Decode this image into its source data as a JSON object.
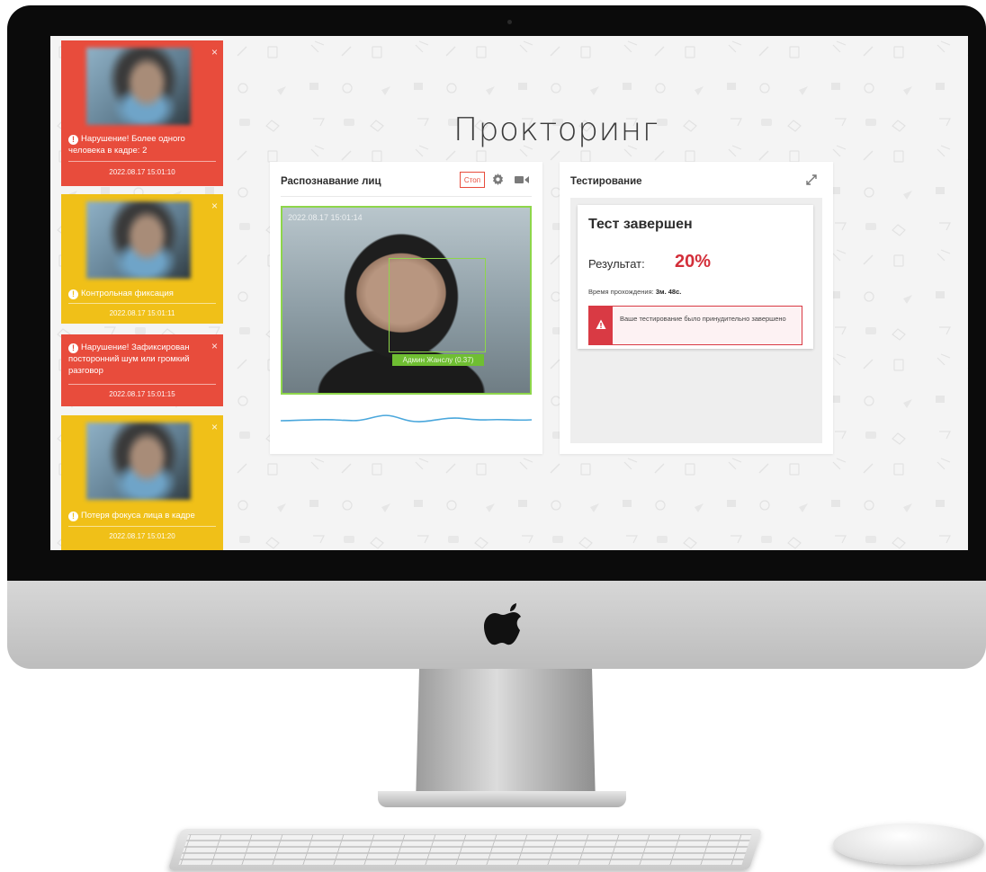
{
  "page": {
    "title": "Прокторинг"
  },
  "notifications": [
    {
      "type": "violation",
      "color": "#e84c3c",
      "text": "Нарушение! Более одного человека в кадре: 2",
      "time": "2022.08.17 15:01:10",
      "close": "×"
    },
    {
      "type": "info",
      "color": "#f0c018",
      "text": "Контрольная фиксация",
      "time": "2022.08.17 15:01:11",
      "close": "×"
    },
    {
      "type": "violation",
      "color": "#e84c3c",
      "text": "Нарушение! Зафиксирован посторонний шум или громкий разговор",
      "time": "2022.08.17 15:01:15",
      "close": "×"
    },
    {
      "type": "info",
      "color": "#f0c018",
      "text": "Потеря фокуса лица в кадре",
      "time": "2022.08.17 15:01:20",
      "close": "×"
    }
  ],
  "face_panel": {
    "title": "Распознавание лиц",
    "stop_label": "Стоп",
    "icons": [
      "gear-icon",
      "camera-icon"
    ],
    "video_timestamp": "2022.08.17 15:01:14",
    "face_label": "Админ Жанслу (0.37)",
    "accent": "#8ed64a"
  },
  "test_panel": {
    "title": "Тестирование",
    "card_title": "Тест завершен",
    "result_label": "Результат:",
    "result_value": "20%",
    "duration_label": "Время прохождения:",
    "duration_value": "3м. 48с.",
    "alert_text": "Ваше тестирование было принудительно завершено",
    "alert_color": "#d93a44"
  }
}
